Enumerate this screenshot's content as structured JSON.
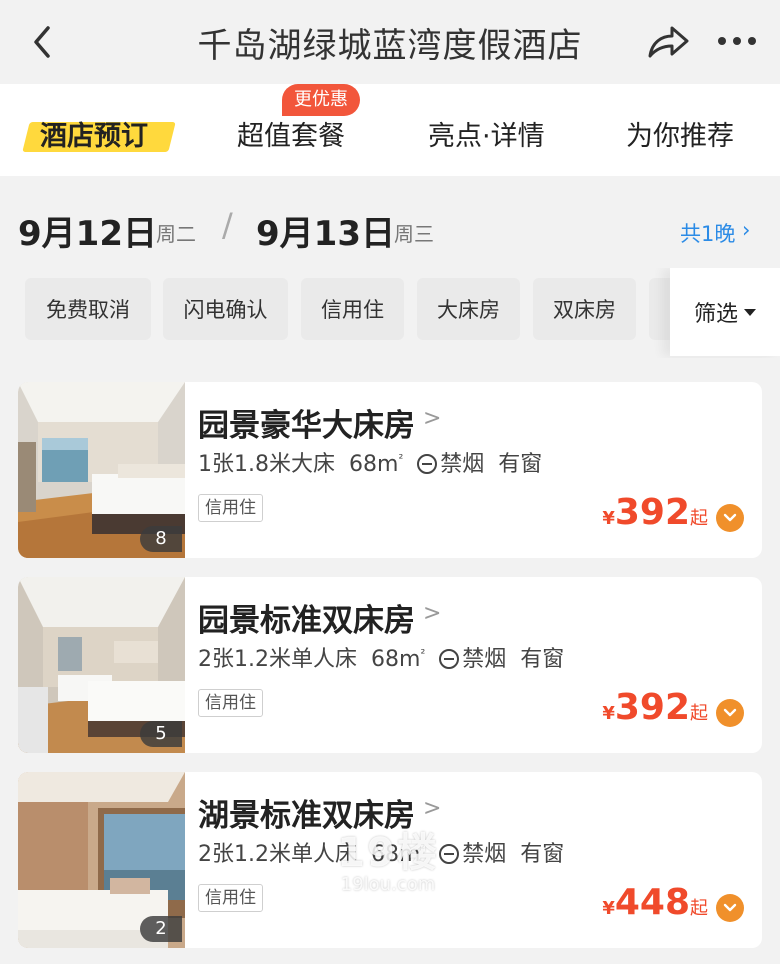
{
  "header": {
    "title": "千岛湖绿城蓝湾度假酒店",
    "back_icon": "chevron-left-icon",
    "share_icon": "share-icon",
    "more_icon": "more-icon"
  },
  "tabs": [
    {
      "label": "酒店预订",
      "active": true
    },
    {
      "label": "超值套餐",
      "badge": "更优惠"
    },
    {
      "label": "亮点·详情"
    },
    {
      "label": "为你推荐"
    }
  ],
  "dates": {
    "checkin": "9月12日",
    "checkin_weekday": "周二",
    "separator": "/",
    "checkout": "9月13日",
    "checkout_weekday": "周三",
    "nights": "共1晚",
    "chevron": "›"
  },
  "filters": {
    "chips": [
      "免费取消",
      "闪电确认",
      "信用住",
      "大床房",
      "双床房"
    ],
    "filter_label": "筛选"
  },
  "rooms": [
    {
      "name": "园景豪华大床房",
      "bed": "1张1.8米大床",
      "area": "68m",
      "area_unit": "²",
      "smoking": "禁烟",
      "window": "有窗",
      "tag": "信用住",
      "currency": "¥",
      "price": "392",
      "price_suffix": "起",
      "photo_count": "8"
    },
    {
      "name": "园景标准双床房",
      "bed": "2张1.2米单人床",
      "area": "68m",
      "area_unit": "²",
      "smoking": "禁烟",
      "window": "有窗",
      "tag": "信用住",
      "currency": "¥",
      "price": "392",
      "price_suffix": "起",
      "photo_count": "5"
    },
    {
      "name": "湖景标准双床房",
      "bed": "2张1.2米单人床",
      "area": "68m",
      "area_unit": "²",
      "smoking": "禁烟",
      "window": "有窗",
      "tag": "信用住",
      "currency": "¥",
      "price": "448",
      "price_suffix": "起",
      "photo_count": "2"
    }
  ],
  "watermark": {
    "line1": "19楼",
    "line2": "19lou.com"
  },
  "colors": {
    "accent": "#f04a2b",
    "highlight": "#ffd93d",
    "link": "#2b8be6",
    "badge": "#f2563b"
  }
}
